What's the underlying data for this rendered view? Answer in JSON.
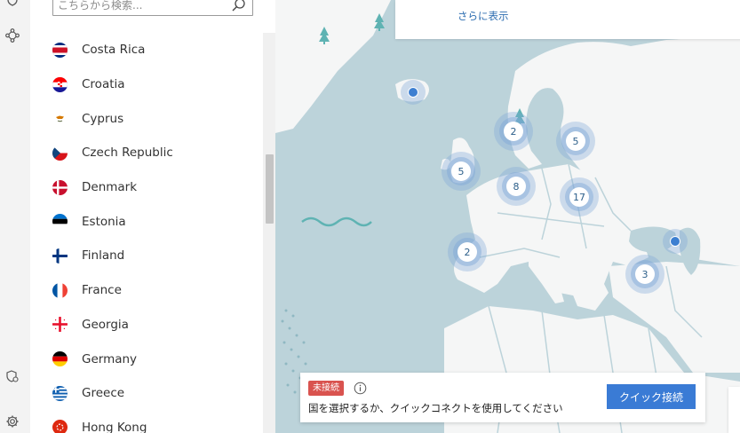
{
  "search": {
    "placeholder": "こちらから検索..."
  },
  "countries": [
    {
      "name": "Costa Rica",
      "flag": "costa-rica-flag-icon"
    },
    {
      "name": "Croatia",
      "flag": "croatia-flag-icon"
    },
    {
      "name": "Cyprus",
      "flag": "cyprus-flag-icon"
    },
    {
      "name": "Czech Republic",
      "flag": "czech-flag-icon"
    },
    {
      "name": "Denmark",
      "flag": "denmark-flag-icon"
    },
    {
      "name": "Estonia",
      "flag": "estonia-flag-icon"
    },
    {
      "name": "Finland",
      "flag": "finland-flag-icon"
    },
    {
      "name": "France",
      "flag": "france-flag-icon"
    },
    {
      "name": "Georgia",
      "flag": "georgia-flag-icon"
    },
    {
      "name": "Germany",
      "flag": "germany-flag-icon"
    },
    {
      "name": "Greece",
      "flag": "greece-flag-icon"
    },
    {
      "name": "Hong Kong",
      "flag": "hong-kong-flag-icon"
    }
  ],
  "map": {
    "more_label": "さらに表示",
    "clusters": [
      "2",
      "5",
      "5",
      "8",
      "17",
      "2",
      "3"
    ]
  },
  "status": {
    "badge": "未接続",
    "message": "国を選択するか、クイックコネクトを使用してください",
    "quick_connect_label": "クイック接続"
  },
  "colors": {
    "accent": "#3a7bd5",
    "disconnected": "#d9534f",
    "sea": "#bcd3da",
    "land": "#f5f6f6",
    "cluster_text": "#2d5f8a"
  }
}
